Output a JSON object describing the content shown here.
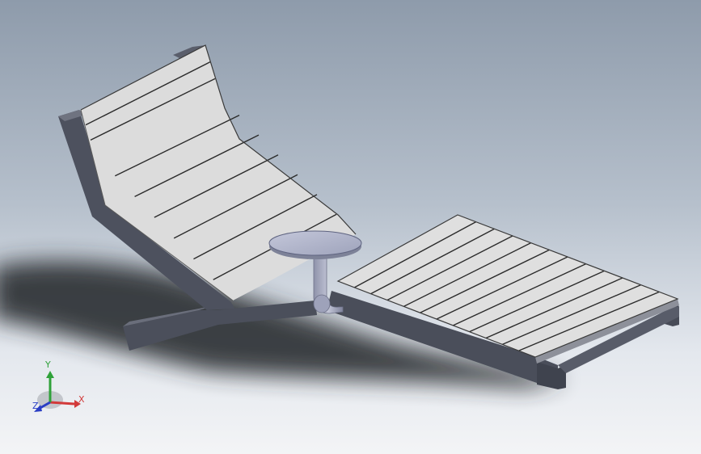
{
  "viewport": {
    "background_top": "#8e9bab",
    "background_bottom": "#f3f4f6"
  },
  "model": {
    "parts": [
      "backrest",
      "seat",
      "frame",
      "side-table",
      "table-post"
    ],
    "backrest_slats": 10,
    "seat_slats": 12,
    "colors": {
      "slat_top": "#dfdfdf",
      "slat_edge": "#2b2b2b",
      "frame_dark": "#474b57",
      "frame_mid": "#5d616e",
      "table_top": "#aeb2c8",
      "shadow": "#2a2d33"
    }
  },
  "triad": {
    "x_label": "X",
    "y_label": "Y",
    "z_label": "Z",
    "x_color": "#d23a3a",
    "y_color": "#2fa13a",
    "z_color": "#2a3ec4"
  }
}
